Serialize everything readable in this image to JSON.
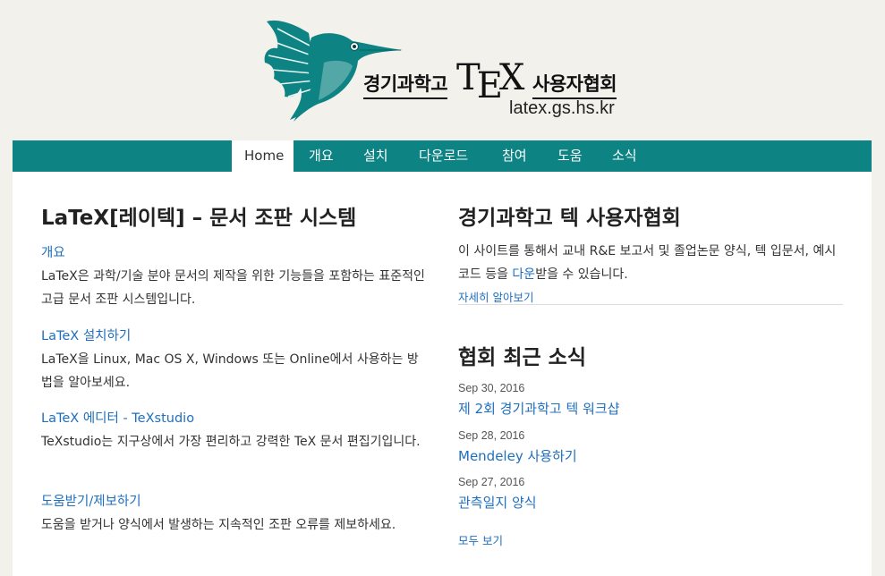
{
  "header": {
    "logo_left": "경기과학고",
    "logo_tex_t": "T",
    "logo_tex_e": "E",
    "logo_tex_x": "X",
    "logo_right": "사용자협회",
    "logo_url": "latex.gs.hs.kr"
  },
  "nav": {
    "items": [
      {
        "label": "Home",
        "active": true
      },
      {
        "label": "개요"
      },
      {
        "label": "설치"
      },
      {
        "label": "다운로드"
      },
      {
        "label": "참여"
      },
      {
        "label": "도움"
      },
      {
        "label": "소식"
      }
    ]
  },
  "left": {
    "title": "LaTeX[레이텍] – 문서 조판 시스템",
    "sections": [
      {
        "link": "개요",
        "desc": "LaTeX은 과학/기술 분야 문서의 제작을 위한 기능들을 포함하는 표준적인 고급 문서 조판 시스템입니다."
      },
      {
        "link": "LaTeX 설치하기",
        "desc": "LaTeX을 Linux, Mac OS X, Windows 또는 Online에서 사용하는 방법을 알아보세요."
      },
      {
        "link": "LaTeX 에디터 - TeXstudio",
        "desc": "TeXstudio는 지구상에서 가장 편리하고 강력한 TeX 문서 편집기입니다."
      },
      {
        "link": "도움받기/제보하기",
        "desc": "도움을 받거나 양식에서 발생하는 지속적인 조판 오류를 제보하세요."
      }
    ]
  },
  "right": {
    "title": "경기과학고 텍 사용자협회",
    "intro_before": "이 사이트를 통해서 교내 R&E 보고서 및 졸업논문 양식, 텍 입문서, 예시 코드 등을 ",
    "intro_link": "다운",
    "intro_after": "받을 수 있습니다.",
    "more_link": "자세히 알아보기",
    "news_title": "협회 최근 소식",
    "news": [
      {
        "date": "Sep 30, 2016",
        "title": "제 2회 경기과학고 텍 워크샵"
      },
      {
        "date": "Sep 28, 2016",
        "title": "Mendeley 사용하기"
      },
      {
        "date": "Sep 27, 2016",
        "title": "관측일지 양식"
      }
    ],
    "all_link": "모두 보기"
  }
}
